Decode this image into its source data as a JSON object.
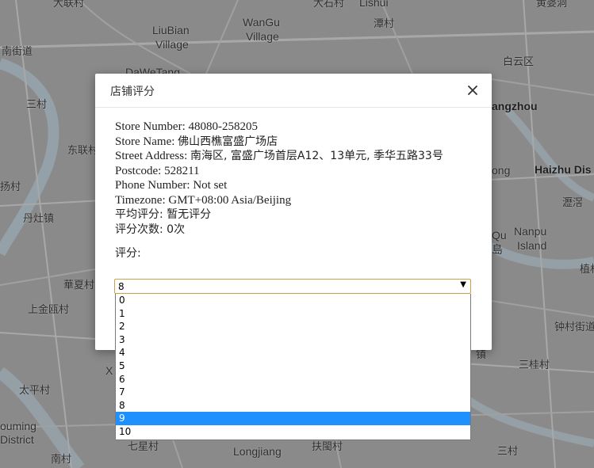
{
  "map": {
    "labels": [
      {
        "text": "大联村"
      },
      {
        "text": "WanGu"
      },
      {
        "text": "Village"
      },
      {
        "text": "大石村"
      },
      {
        "text": "Lishui"
      },
      {
        "text": "黄婆洞"
      },
      {
        "text": "LiuBian"
      },
      {
        "text": "Village"
      },
      {
        "text": "潭村"
      },
      {
        "text": "南街道"
      },
      {
        "text": "DaWeTang"
      },
      {
        "text": "白云区"
      },
      {
        "text": "三村"
      },
      {
        "text": "angzhou"
      },
      {
        "text": "东联村"
      },
      {
        "text": "ong"
      },
      {
        "text": "Haizhu Dis"
      },
      {
        "text": "扬村"
      },
      {
        "text": "丹灶镇"
      },
      {
        "text": "瀝滘"
      },
      {
        "text": "Nanpu"
      },
      {
        "text": "Island"
      },
      {
        "text": "Qu"
      },
      {
        "text": "島"
      },
      {
        "text": "華夏村"
      },
      {
        "text": "植村"
      },
      {
        "text": "上金瓯村"
      },
      {
        "text": "钟村街道"
      },
      {
        "text": "镇"
      },
      {
        "text": "三桂村"
      },
      {
        "text": "X"
      },
      {
        "text": "太平村"
      },
      {
        "text": "ouming"
      },
      {
        "text": "District"
      },
      {
        "text": "南村"
      },
      {
        "text": "七星村"
      },
      {
        "text": "Longjiang"
      },
      {
        "text": "扶閩村"
      },
      {
        "text": "三村"
      },
      {
        "text": "村"
      }
    ]
  },
  "dialog": {
    "title": "店铺评分",
    "close_icon": "close-icon",
    "info": {
      "store_number": "Store Number: 48080-258205",
      "store_name_prefix": "Store Name: ",
      "store_name": "佛山西樵富盛广场店",
      "street_prefix": "Street Address: ",
      "street": "南海区, 富盛广场首层A12、13单元, 季华五路33号",
      "postcode": "Postcode: 528211",
      "phone": "Phone Number: Not set",
      "timezone": "Timezone: GMT+08:00 Asia/Beijing",
      "avg_rating": "平均评分: 暂无评分",
      "rating_count": "评分次数: 0次"
    },
    "rating_label": "评分:",
    "select": {
      "value": "8",
      "options": [
        "0",
        "1",
        "2",
        "3",
        "4",
        "5",
        "6",
        "7",
        "8",
        "9",
        "10"
      ],
      "highlighted": "9"
    }
  },
  "colors": {
    "highlight": "#1e90ff",
    "select_border": "#c9a24a"
  }
}
